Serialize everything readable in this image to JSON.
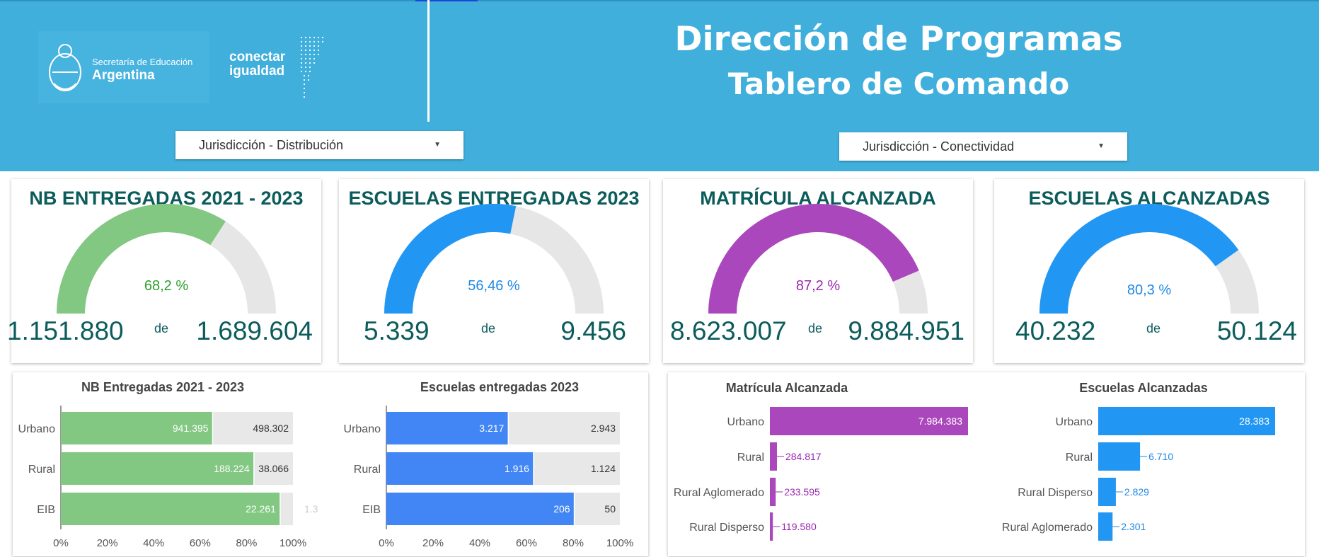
{
  "header": {
    "title_line1": "Dirección de Programas",
    "title_line2": "Tablero de Comando",
    "logo_secretaria_line1": "Secretaría de Educación",
    "logo_secretaria_line2": "Argentina",
    "logo_conectar_line1": "conectar",
    "logo_conectar_line2": "igualdad"
  },
  "filters": {
    "distribucion_label": "Jurisdicción - Distribución",
    "conectividad_label": "Jurisdicción - Conectividad"
  },
  "gauges": [
    {
      "title": "NB ENTREGADAS 2021 - 2023",
      "pct_label": "68,2 %",
      "fraction": 0.682,
      "value": "1.151.880",
      "de": "de",
      "total": "1.689.604",
      "color": "#82c782",
      "pct_color": "#2ca02c"
    },
    {
      "title": "ESCUELAS ENTREGADAS 2023",
      "pct_label": "56,46 %",
      "fraction": 0.5646,
      "value": "5.339",
      "de": "de",
      "total": "9.456",
      "color": "#2196f3",
      "pct_color": "#1e88e5"
    },
    {
      "title": "MATRÍCULA ALCANZADA",
      "pct_label": "87,2 %",
      "fraction": 0.872,
      "value": "8.623.007",
      "de": "de",
      "total": "9.884.951",
      "color": "#ab47bc",
      "pct_color": "#9c27b0"
    },
    {
      "title": "ESCUELAS ALCANZADAS",
      "pct_label": "80,3 %",
      "fraction": 0.803,
      "value": "40.232",
      "de": "de",
      "total": "50.124",
      "color": "#2196f3",
      "pct_color": "#1e88e5"
    }
  ],
  "chart_data": [
    {
      "type": "bar",
      "stacked_percent": true,
      "title": "NB Entregadas 2021 - 2023",
      "categories": [
        "Urbano",
        "Rural",
        "EIB"
      ],
      "series": [
        {
          "values": [
            941395,
            188224,
            22261
          ],
          "labels": [
            "941.395",
            "188.224",
            "22.261"
          ],
          "color": "#82c782"
        },
        {
          "values": [
            498302,
            38066,
            1300
          ],
          "labels": [
            "498.302",
            "38.066",
            "1.3"
          ],
          "color": "#e8e8e8"
        }
      ],
      "xticks": [
        "0%",
        "20%",
        "40%",
        "60%",
        "80%",
        "100%"
      ],
      "xlim": [
        0,
        100
      ]
    },
    {
      "type": "bar",
      "stacked_percent": true,
      "title": "Escuelas entregadas 2023",
      "categories": [
        "Urbano",
        "Rural",
        "EIB"
      ],
      "series": [
        {
          "values": [
            3217,
            1916,
            206
          ],
          "labels": [
            "3.217",
            "1.916",
            "206"
          ],
          "color": "#4285f4"
        },
        {
          "values": [
            2943,
            1124,
            50
          ],
          "labels": [
            "2.943",
            "1.124",
            "50"
          ],
          "color": "#e8e8e8"
        }
      ],
      "xticks": [
        "0%",
        "20%",
        "40%",
        "60%",
        "80%",
        "100%"
      ],
      "xlim": [
        0,
        100
      ]
    },
    {
      "type": "bar",
      "title": "Matrícula Alcanzada",
      "categories": [
        "Urbano",
        "Rural",
        "Rural Aglomerado",
        "Rural Disperso"
      ],
      "values": [
        7984383,
        284817,
        233595,
        119580
      ],
      "labels": [
        "7.984.383",
        "284.817",
        "233.595",
        "119.580"
      ],
      "color": "#ab47bc"
    },
    {
      "type": "bar",
      "title": "Escuelas Alcanzadas",
      "categories": [
        "Urbano",
        "Rural",
        "Rural Disperso",
        "Rural Aglomerado"
      ],
      "values": [
        28383,
        6710,
        2829,
        2301
      ],
      "labels": [
        "28.383",
        "6.710",
        "2.829",
        "2.301"
      ],
      "color": "#2196f3"
    }
  ]
}
